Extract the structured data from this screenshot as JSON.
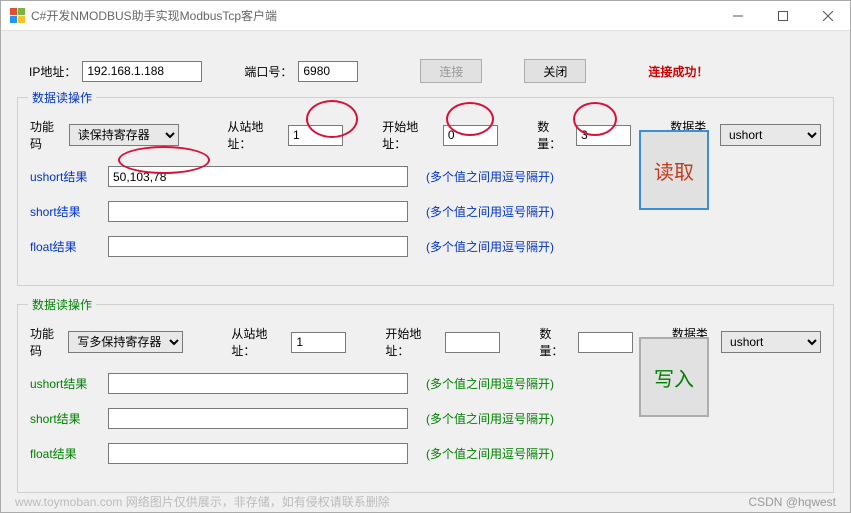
{
  "window": {
    "title": "C#开发NMODBUS助手实现ModbusTcp客户端"
  },
  "connection": {
    "ip_label": "IP地址：",
    "ip_value": "192.168.1.188",
    "port_label": "端口号：",
    "port_value": "6980",
    "connect_label": "连接",
    "close_label": "关闭",
    "status_text": "连接成功！"
  },
  "read_group": {
    "title": "数据读操作",
    "func_label": "功能码",
    "func_value": "读保持寄存器",
    "slave_label": "从站地址：",
    "slave_value": "1",
    "start_label": "开始地址：",
    "start_value": "0",
    "count_label": "数量：",
    "count_value": "3",
    "type_label": "数据类型",
    "type_value": "ushort",
    "ushort_label": "ushort结果",
    "ushort_value": "50,103,78",
    "short_label": "short结果",
    "short_value": "",
    "float_label": "float结果",
    "float_value": "",
    "hint": "(多个值之间用逗号隔开)",
    "button_label": "读取"
  },
  "write_group": {
    "title": "数据读操作",
    "func_label": "功能码",
    "func_value": "写多保持寄存器",
    "slave_label": "从站地址：",
    "slave_value": "1",
    "start_label": "开始地址：",
    "start_value": "",
    "count_label": "数量：",
    "count_value": "",
    "type_label": "数据类型",
    "type_value": "ushort",
    "ushort_label": "ushort结果",
    "ushort_value": "",
    "short_label": "short结果",
    "short_value": "",
    "float_label": "float结果",
    "float_value": "",
    "hint": "(多个值之间用逗号隔开)",
    "button_label": "写入"
  },
  "footer": {
    "left": "www.toymoban.com  网络图片仅供展示，非存储，如有侵权请联系删除",
    "right": "CSDN @hqwest"
  }
}
